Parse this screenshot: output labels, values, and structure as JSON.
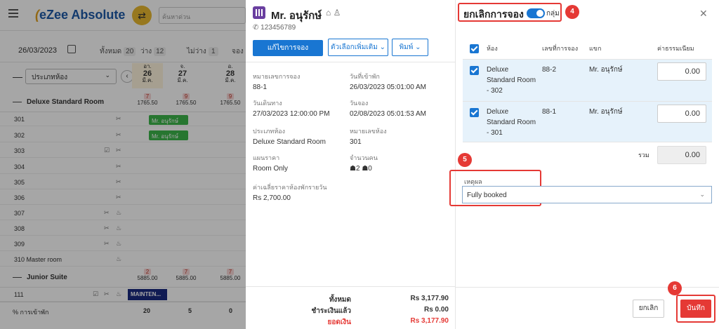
{
  "app": {
    "logo": "eZee Absolute",
    "search_placeholder": "ค้นหาด่วน"
  },
  "filterbar": {
    "date": "26/03/2023",
    "stats": [
      {
        "label": "ทั้งหมด",
        "count": "20"
      },
      {
        "label": "ว่าง",
        "count": "12"
      },
      {
        "label": "ไม่ว่าง",
        "count": "1"
      },
      {
        "label": "จอง",
        "count": ""
      }
    ]
  },
  "grid": {
    "roomtype_filter": "ประเภทห้อง",
    "days": [
      {
        "dow": "อา.",
        "num": "26",
        "mon": "มี.ค."
      },
      {
        "dow": "จ.",
        "num": "27",
        "mon": "มี.ค."
      },
      {
        "dow": "อ.",
        "num": "28",
        "mon": "มี.ค."
      }
    ],
    "room_types": [
      {
        "name": "Deluxe Standard Room",
        "avail": [
          {
            "count": "7",
            "rate": "1765.50"
          },
          {
            "count": "9",
            "rate": "1765.50"
          },
          {
            "count": "9",
            "rate": "1765.50"
          }
        ],
        "rooms": [
          "301",
          "302",
          "303",
          "304",
          "305",
          "306",
          "307",
          "308",
          "309",
          "310 Master room"
        ]
      },
      {
        "name": "Junior Suite",
        "avail": [
          {
            "count": "2",
            "rate": "5885.00"
          },
          {
            "count": "7",
            "rate": "5885.00"
          },
          {
            "count": "7",
            "rate": "5885.00"
          }
        ],
        "rooms": [
          "111"
        ]
      }
    ],
    "bookings": [
      "Mr. อนุรักษ์",
      "Mr. อนุรักษ์"
    ],
    "maintenance": "MAINTEN...",
    "occupancy": {
      "label": "% การเข้าพัก",
      "values": [
        "20",
        "5",
        "0"
      ]
    }
  },
  "details": {
    "guest_name": "Mr. อนุรักษ์",
    "phone": "123456789",
    "btn_edit": "แก้ไขการจอง",
    "btn_more": "ตัวเลือกเพิ่มเติม",
    "btn_print": "พิมพ์",
    "fields": {
      "res_no_label": "หมายเลขการจอง",
      "res_no": "88-1",
      "checkin_label": "วันที่เข้าพัก",
      "checkin": "26/03/2023 05:01:00 AM",
      "checkout_label": "วันเดินทาง",
      "checkout": "27/03/2023 12:00:00 PM",
      "booked_label": "วันจอง",
      "booked": "02/08/2023 05:01:53 AM",
      "roomtype_label": "ประเภทห้อง",
      "roomtype": "Deluxe Standard Room",
      "roomno_label": "หมายเลขห้อง",
      "roomno": "301",
      "rateplan_label": "แผนราคา",
      "rateplan": "Room Only",
      "pax_label": "จำนวนคน",
      "adults": "2",
      "children": "0",
      "avg_label": "ค่าเฉลี่ยราคาห้องพักรายวัน",
      "avg": "Rs 2,700.00"
    },
    "totals": [
      {
        "label": "ทั้งหมด",
        "value": "Rs 3,177.90"
      },
      {
        "label": "ชำระเงินแล้ว",
        "value": "Rs 0.00"
      },
      {
        "label": "ยอดเงิน",
        "value": "Rs 3,177.90"
      }
    ]
  },
  "dialog": {
    "title": "ยกเลิกการจอง",
    "toggle_label": "กลุ่ม",
    "steps": [
      "4",
      "5",
      "6"
    ],
    "headers": {
      "room": "ห้อง",
      "res_no": "เลขที่การจอง",
      "guest": "แขก",
      "fee": "ค่าธรรมเนียม"
    },
    "rows": [
      {
        "room_l1": "Deluxe",
        "room_l2": "Standard Room",
        "room_l3": "- 302",
        "res_no": "88-2",
        "guest": "Mr. อนุรักษ์",
        "fee": "0.00"
      },
      {
        "room_l1": "Deluxe",
        "room_l2": "Standard Room",
        "room_l3": "- 301",
        "res_no": "88-1",
        "guest": "Mr. อนุรักษ์",
        "fee": "0.00"
      }
    ],
    "sum_label": "รวม",
    "sum_value": "0.00",
    "reason_label": "เหตุผล",
    "reason_value": "Fully booked",
    "btn_cancel": "ยกเลิก",
    "btn_save": "บันทึก"
  },
  "colors": {
    "primary": "#1976d2",
    "accent_red": "#e53935",
    "booking_green": "#3cb54a",
    "maintenance_navy": "#1a2a80"
  }
}
